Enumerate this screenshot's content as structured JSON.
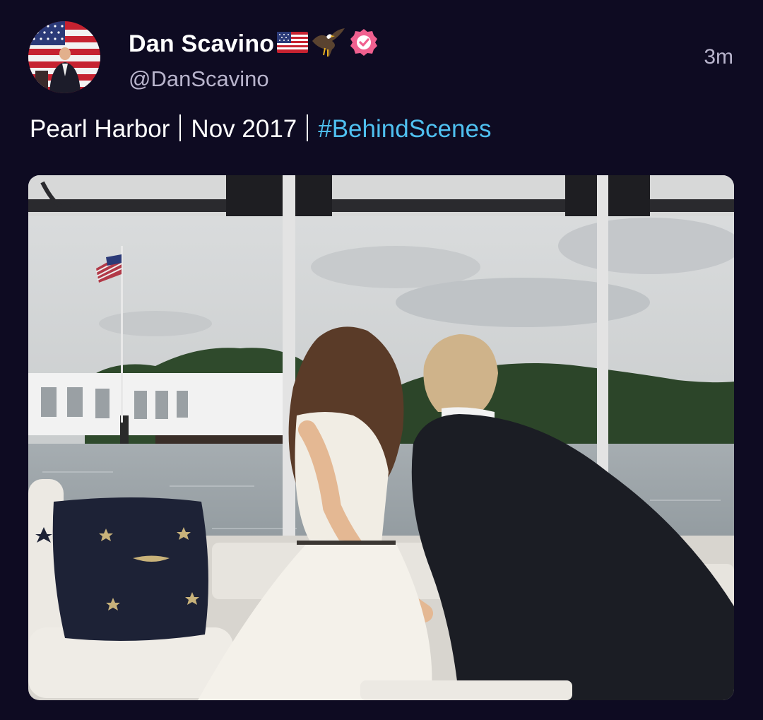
{
  "tweet": {
    "author": {
      "display_name": "Dan Scavino",
      "flag_emoji": "🇺🇸",
      "eagle_emoji": "🦅",
      "verified_icon": "verified-badge-icon",
      "handle": "@DanScavino"
    },
    "timestamp": "3m",
    "text": {
      "part1": "Pearl Harbor",
      "part2": "Nov 2017",
      "hashtag": "#BehindScenes"
    },
    "media": {
      "kind": "photo"
    }
  },
  "colors": {
    "background": "#0e0b22",
    "hashtag": "#4fc0f0",
    "verified_badge": "#f0608f",
    "secondary_text": "#b8b4cc"
  }
}
